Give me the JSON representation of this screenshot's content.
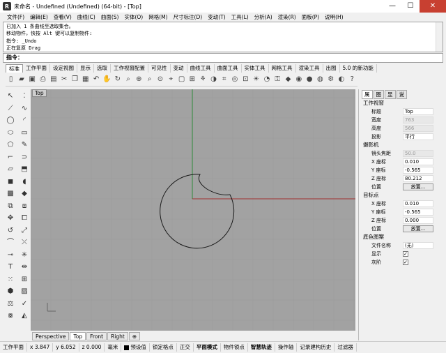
{
  "window": {
    "title": "未命名 - Undefined (Undefined) (64-bit) - [Top]",
    "minimize": "—",
    "maximize": "☐",
    "close": "✕"
  },
  "menu": [
    "文件(F)",
    "编辑(E)",
    "查看(V)",
    "曲线(C)",
    "曲面(S)",
    "实体(O)",
    "网格(M)",
    "尺寸标注(D)",
    "变动(T)",
    "工具(L)",
    "分析(A)",
    "渲染(R)",
    "面板(P)",
    "说明(H)"
  ],
  "command_history": [
    "已加入 1 条曲线至选取集合。",
    "移动物件，快按 Alt 键可以复制物件:",
    "指令: _Undo",
    "正在复原 Drag"
  ],
  "command_prompt": "指令：",
  "toolbar_tabs": [
    "标准",
    "工作平面",
    "设定视图",
    "显示",
    "选取",
    "工作视窗配置",
    "可见性",
    "变动",
    "曲线工具",
    "曲面工具",
    "实体工具",
    "网格工具",
    "渲染工具",
    "出图",
    "5.0 的新功能"
  ],
  "viewport": {
    "name": "Top",
    "tabs": [
      "Perspective",
      "Top",
      "Front",
      "Right"
    ],
    "add_tab": "⊕",
    "background": "#a2a2a2",
    "grid_color": "#9b9b9b",
    "x_axis_color": "#a03030",
    "y_axis_color": "#2e8b3a"
  },
  "properties": {
    "tabs": [
      "属",
      "图",
      "显",
      "说"
    ],
    "viewport_section": "工作视窗",
    "title_label": "标题",
    "title_value": "Top",
    "width_label": "宽度",
    "width_value": "763",
    "height_label": "高度",
    "height_value": "566",
    "projection_label": "投影",
    "projection_value": "平行",
    "camera_section": "摄影机",
    "lens_label": "镜头焦距",
    "lens_value": "50.0",
    "cx_label": "X 座标",
    "cx_value": "0.010",
    "cy_label": "Y 座标",
    "cy_value": "-0.565",
    "cz_label": "Z 座标",
    "cz_value": "80.212",
    "cpos_label": "位置",
    "cpos_btn": "放置...",
    "target_section": "目标点",
    "tx_label": "X 座标",
    "tx_value": "0.010",
    "ty_label": "Y 座标",
    "ty_value": "-0.565",
    "tz_label": "Z 座标",
    "tz_value": "0.000",
    "tpos_label": "位置",
    "tpos_btn": "放置...",
    "bg_section": "底色图案",
    "file_label": "文件名称",
    "file_value": "(无)",
    "show_label": "显示",
    "show_checked": "✓",
    "gray_label": "灰阶",
    "gray_checked": "✓"
  },
  "status": {
    "plane": "工作平面",
    "x": "x 3.847",
    "y": "y 6.052",
    "z": "z 0.000",
    "unit": "毫米",
    "layer": "预设值",
    "snap": "锁定格点",
    "ortho": "正交",
    "planar": "平面模式",
    "osnap": "物件锁点",
    "smarttrack": "智慧轨迹",
    "gumball": "操作轴",
    "history": "记录建构历史",
    "filter": "过滤器"
  }
}
